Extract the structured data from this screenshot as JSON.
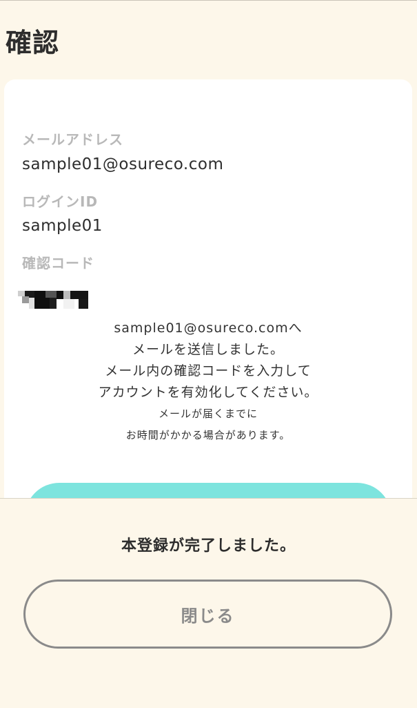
{
  "header": {
    "title": "確認"
  },
  "card": {
    "email_label": "メールアドレス",
    "email_value": "sample01@osureco.com",
    "login_id_label": "ログインID",
    "login_id_value": "sample01",
    "code_label": "確認コード"
  },
  "info": {
    "lines": [
      "sample01@osureco.comへ",
      "メールを送信しました。",
      "メール内の確認コードを入力して",
      "アカウントを有効化してください。"
    ],
    "note_lines": [
      "メールが届くまでに",
      "お時間がかかる場合があります。"
    ]
  },
  "colors": {
    "background": "#fdf7ea",
    "card": "#ffffff",
    "accent": "#7de4de",
    "label": "#b8b8b8",
    "button_border": "#8a8a8a"
  },
  "sheet": {
    "message": "本登録が完了しました。",
    "close_label": "閉じる"
  }
}
